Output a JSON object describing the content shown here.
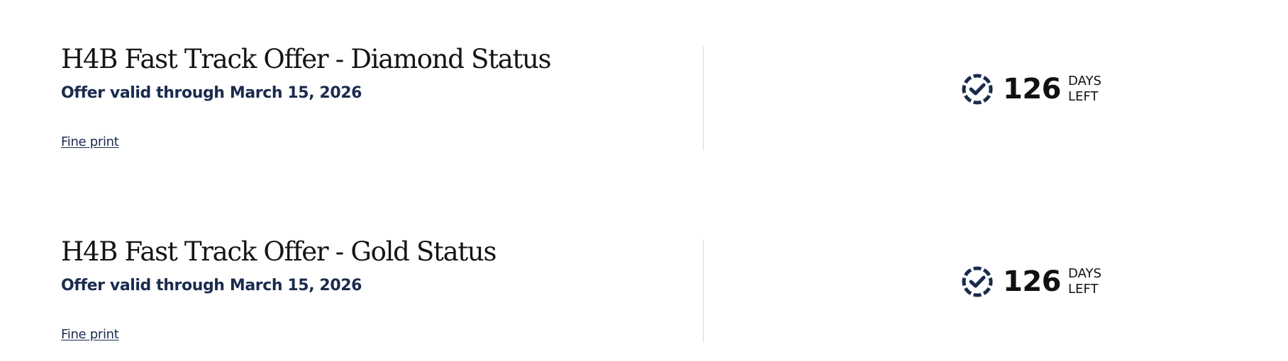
{
  "offers": [
    {
      "title": "H4B Fast Track Offer - Diamond Status",
      "valid_text": "Offer valid through March 15, 2026",
      "fine_print_label": "Fine print",
      "days_left": "126",
      "days_label_top": "DAYS",
      "days_label_bottom": "LEFT"
    },
    {
      "title": "H4B Fast Track Offer - Gold Status",
      "valid_text": "Offer valid through March 15, 2026",
      "fine_print_label": "Fine print",
      "days_left": "126",
      "days_label_top": "DAYS",
      "days_label_bottom": "LEFT"
    }
  ],
  "icons": {
    "countdown": "clock-check-icon"
  },
  "colors": {
    "navy": "#1a2b4e",
    "divider": "#d9d9d9",
    "title": "#141414"
  }
}
